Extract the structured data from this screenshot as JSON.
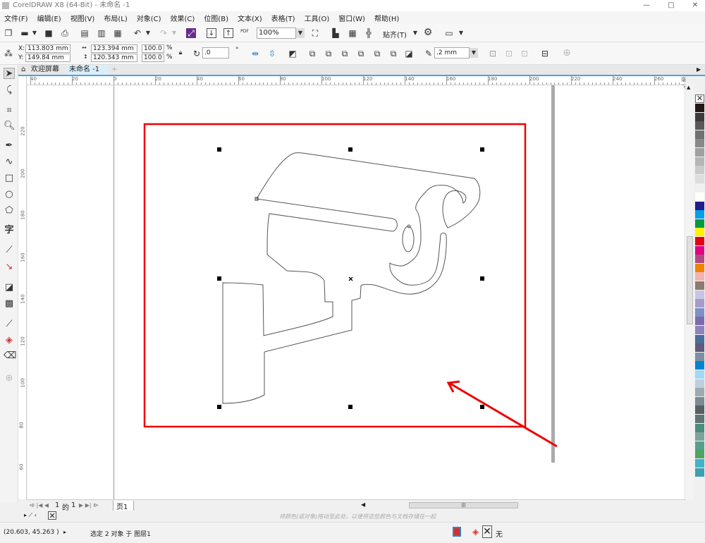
{
  "window": {
    "title": "CorelDRAW X8 (64-Bit) - 未命名 -1",
    "minimize": "—",
    "maximize": "□",
    "close": "✕"
  },
  "menu": [
    "文件(F)",
    "编辑(E)",
    "视图(V)",
    "布局(L)",
    "对象(C)",
    "效果(C)",
    "位图(B)",
    "文本(X)",
    "表格(T)",
    "工具(O)",
    "窗口(W)",
    "帮助(H)"
  ],
  "toolbar": {
    "zoom": "100%",
    "snap": "贴齐(T)",
    "pdf": "PDF"
  },
  "propertybar": {
    "x_label": "X:",
    "x": "113.803 mm",
    "y_label": "Y:",
    "y": "149.84 mm",
    "width": "123.394 mm",
    "height": "120.343 mm",
    "scale_w": "100.0",
    "scale_h": "100.0",
    "pct": "%",
    "rotation": ".0",
    "degree": "°",
    "outline": ".2 mm"
  },
  "tabs": {
    "welcome": "欢迎屏幕",
    "document": "未命名 -1",
    "add": "+"
  },
  "ruler": {
    "h_labels": [
      "40",
      "20",
      "0",
      "20",
      "40",
      "60",
      "80",
      "100",
      "120",
      "140",
      "160",
      "180",
      "200",
      "220",
      "240",
      "260"
    ],
    "unit": "毫米",
    "v_labels": [
      "220",
      "200",
      "180",
      "160",
      "140",
      "120",
      "100",
      "80",
      "60"
    ]
  },
  "pagenav": {
    "current": "1",
    "of": "的",
    "total": "1",
    "page_tab": "页1"
  },
  "colorhint": "将颜色(或对象)拖动至此处，以便将这些颜色与文档存储在一起",
  "status": {
    "coords": "(20.603, 45.263 )",
    "selection": "选定 2 对象 于 图层1",
    "fill_none": "无"
  },
  "palette": [
    "#231815",
    "#3e3a39",
    "#595757",
    "#727171",
    "#898989",
    "#9fa0a0",
    "#b5b5b6",
    "#c9caca",
    "#dcdddd",
    "#efefef",
    "#ffffff",
    "#1d2088",
    "#00a0e9",
    "#009944",
    "#fff100",
    "#e60012",
    "#e4007f",
    "#b5487f",
    "#f08300",
    "#f5b2b2",
    "#8c7b6e",
    "#c9c3e6",
    "#a59aca",
    "#7f8fc6",
    "#7b6bae",
    "#8f82bc",
    "#4c6c9b",
    "#5f5a7e",
    "#7e8fa3",
    "#0083d0",
    "#9fd9f6",
    "#bccfde",
    "#9ea9b1",
    "#7d8a90",
    "#595e63",
    "#5f7574",
    "#4b8c7e",
    "#7ea399",
    "#55a08a",
    "#4fa364",
    "#42b3c8",
    "#3d9fb0"
  ]
}
